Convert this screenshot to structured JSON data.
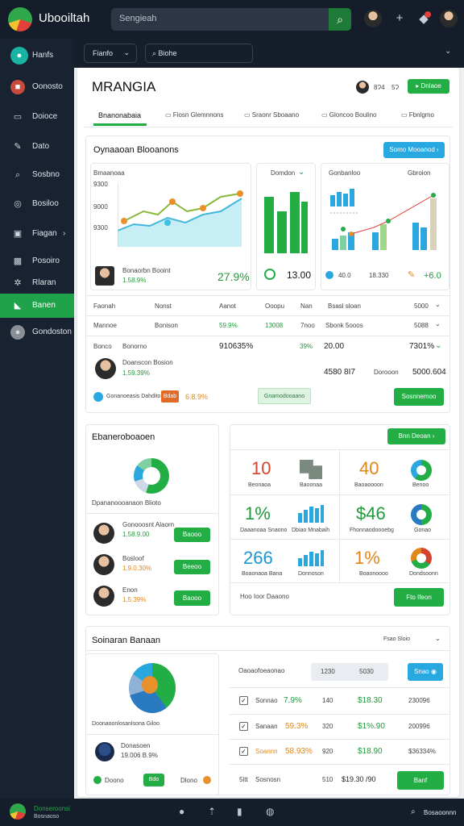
{
  "app": {
    "title": "Ubooiltah",
    "search_placeholder": "Sengieah"
  },
  "sidebar": {
    "items": [
      {
        "label": "Hanfs",
        "icon": "home-icon"
      },
      {
        "label": "Oonosto",
        "icon": "folder-icon"
      },
      {
        "label": "Doioce",
        "icon": "monitor-icon"
      },
      {
        "label": "Dato",
        "icon": "pen-icon"
      },
      {
        "label": "Sosbno",
        "icon": "search-icon"
      },
      {
        "label": "Bosiloo",
        "icon": "globe-icon"
      },
      {
        "label": "Fiagan",
        "icon": "terminal-icon"
      },
      {
        "label": "Posoiro",
        "icon": "image-icon"
      },
      {
        "label": "Rlaran",
        "icon": "gear-icon"
      },
      {
        "label": "Banen",
        "icon": "chart-icon"
      },
      {
        "label": "Gondoston",
        "icon": "user-icon"
      }
    ]
  },
  "toolbar": {
    "select": "Fianfo",
    "search": "Biohe"
  },
  "header": {
    "title": "MRANGIA",
    "count1": "8Ɂ4",
    "count2": "5Ɂ",
    "button": "Dnlaoe"
  },
  "tabs": [
    "Bnanonabaia",
    "Fiosn Glemnnons",
    "Sraonr Sboaano",
    "Gloncoo Boulino",
    "Fbnlgmo"
  ],
  "overview": {
    "title": "Oynaaoan Blooanons",
    "button": "Somo Mooanod",
    "chart1": {
      "label": "Bmaanoaa",
      "y_ticks": [
        "9300",
        "9000",
        "9300"
      ],
      "value": "27.9%",
      "user_name": "Bonaorbn Booint",
      "user_value": "1.58.9%"
    },
    "chart2": {
      "label": "Domdon",
      "value": "13.00"
    },
    "chart3": {
      "label": "Gonbanloo",
      "right_label": "Gbroion",
      "values": [
        "40.0",
        "18.330",
        "+6.0"
      ]
    }
  },
  "table": {
    "header": [
      "Faonah",
      "Nonst",
      "Aanot",
      "Ooopu",
      "Nan",
      "Bsasl sloan",
      "5000"
    ],
    "row1": [
      "Mannoe",
      "Bonison",
      "59.9%",
      "13008",
      "7noo",
      "Sbonk 5ooos",
      "5088"
    ],
    "row2": [
      "Bonco",
      "Bonorno",
      "910635%",
      "39%",
      "20.00",
      "7301%"
    ],
    "person": {
      "name": "Doanscon Bosion",
      "value": "1.59.39%"
    },
    "right_values": [
      "4580 8I7",
      "Dorooon",
      "5000.604"
    ],
    "footer": {
      "text": "Gonanoeasis Dahdito",
      "badge": "Bdab",
      "pct": "6.8.9%",
      "pill": "Gnamodooaano",
      "button": "Sosnnemoo"
    }
  },
  "donut_panel": {
    "title": "Ebaneroboaoen",
    "caption": "Dpananoooanaon Blioto",
    "people": [
      {
        "name": "Gonooosnt Alaorn",
        "value": "1.58.9.00",
        "button": "Baooo"
      },
      {
        "name": "Bosloof",
        "value": "1.9.0.30%",
        "button": "Beeoo"
      },
      {
        "name": "Enon",
        "value": "1.5.39%",
        "button": "Baooo"
      }
    ]
  },
  "grid_panel": {
    "button": "Bnn Deoan",
    "tiles": [
      {
        "value": "10",
        "label": "Beonaoa",
        "color": "#d4442c"
      },
      {
        "value": "",
        "label": "Baoonaa",
        "icon": "puzzle-icon"
      },
      {
        "value": "40",
        "label": "Baoaoooon",
        "color": "#e0861a"
      },
      {
        "value": "",
        "label": "Benoo",
        "icon": "pie-icon"
      },
      {
        "value": "1%",
        "label": "Daaanoaa Snaono",
        "color": "#1f9a3c"
      },
      {
        "value": "",
        "label": "Dbiao Mnabaih",
        "icon": "bars-icon"
      },
      {
        "value": "$46",
        "label": "Fhonnaodoooebg",
        "color": "#1f9a3c"
      },
      {
        "value": "",
        "label": "Gonao",
        "icon": "pie-icon"
      },
      {
        "value": "266",
        "label": "Boaonaoa Bana",
        "color": "#1d95d4"
      },
      {
        "value": "",
        "label": "Donnoson",
        "icon": "bars-icon"
      },
      {
        "value": "1%",
        "label": "Boaonoooo",
        "color": "#e0861a"
      },
      {
        "value": "",
        "label": "Dondsoonn",
        "icon": "pie-icon"
      }
    ],
    "footer_text": "Hoo Ioor Daaono",
    "footer_button": "Fto Ifeon"
  },
  "bottom_section": {
    "title": "Soinaran Banaan",
    "select": "Fsao Sloio",
    "pie_caption": "Doonaoonlosanlsona Giloo",
    "person": {
      "name": "Donasoen",
      "value": "19.006 B.9%"
    },
    "legend": [
      "Doono",
      "Bdo",
      "Dlono"
    ],
    "table_title": "Oaoaofoeaonao",
    "seg": [
      "1230",
      "5030"
    ],
    "button": "Snao",
    "rows": [
      {
        "name": "Sonnao",
        "pct": "7.9%",
        "qty": "140",
        "price": "$18.30",
        "total": "230096"
      },
      {
        "name": "Sanaan",
        "pct": "59.3%",
        "qty": "320",
        "price": "$1%.90",
        "total": "200996"
      },
      {
        "name": "Soannn",
        "pct": "58.93%",
        "qty": "920",
        "price": "$18.90",
        "total": "$36334%"
      }
    ],
    "foot": {
      "left": "5itt",
      "name": "Sosnosn",
      "qty": "510",
      "price": "$19.30 /90",
      "button": "Banf"
    }
  },
  "bottombar": {
    "label1": "Donseroonsi",
    "label2": "Bosnaoso",
    "right": "Bosaoonnn"
  }
}
